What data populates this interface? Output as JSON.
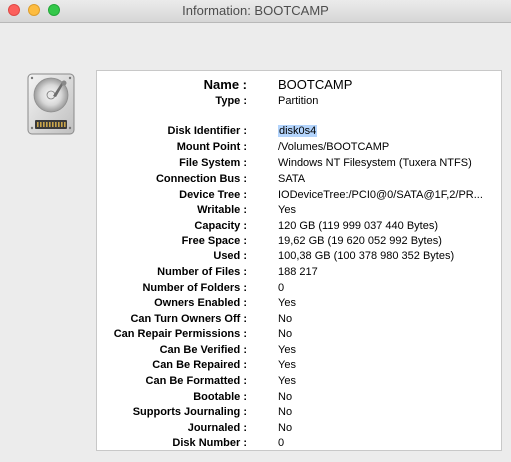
{
  "window": {
    "title": "Information: BOOTCAMP"
  },
  "icon": {
    "name": "hard-disk-icon"
  },
  "header": {
    "name_label": "Name :",
    "name_value": "BOOTCAMP",
    "type_label": "Type :",
    "type_value": "Partition"
  },
  "fields": [
    {
      "label": "Disk Identifier :",
      "value": "disk0s4"
    },
    {
      "label": "Mount Point :",
      "value": "/Volumes/BOOTCAMP"
    },
    {
      "label": "File System :",
      "value": "Windows NT Filesystem (Tuxera NTFS)"
    },
    {
      "label": "Connection Bus :",
      "value": "SATA"
    },
    {
      "label": "Device Tree :",
      "value": "IODeviceTree:/PCI0@0/SATA@1F,2/PR..."
    },
    {
      "label": "Writable :",
      "value": "Yes"
    },
    {
      "label": "Capacity :",
      "value": "120 GB (119 999 037 440 Bytes)"
    },
    {
      "label": "Free Space :",
      "value": "19,62 GB (19 620 052 992 Bytes)"
    },
    {
      "label": "Used :",
      "value": "100,38 GB (100 378 980 352 Bytes)"
    },
    {
      "label": "Number of Files :",
      "value": "188 217"
    },
    {
      "label": "Number of Folders :",
      "value": "0"
    },
    {
      "label": "Owners Enabled :",
      "value": "Yes"
    },
    {
      "label": "Can Turn Owners Off :",
      "value": "No"
    },
    {
      "label": "Can Repair Permissions :",
      "value": "No"
    },
    {
      "label": "Can Be Verified :",
      "value": "Yes"
    },
    {
      "label": "Can Be Repaired :",
      "value": "Yes"
    },
    {
      "label": "Can Be Formatted :",
      "value": "Yes"
    },
    {
      "label": "Bootable :",
      "value": "No"
    },
    {
      "label": "Supports Journaling :",
      "value": "No"
    },
    {
      "label": "Journaled :",
      "value": "No"
    },
    {
      "label": "Disk Number :",
      "value": "0"
    }
  ]
}
